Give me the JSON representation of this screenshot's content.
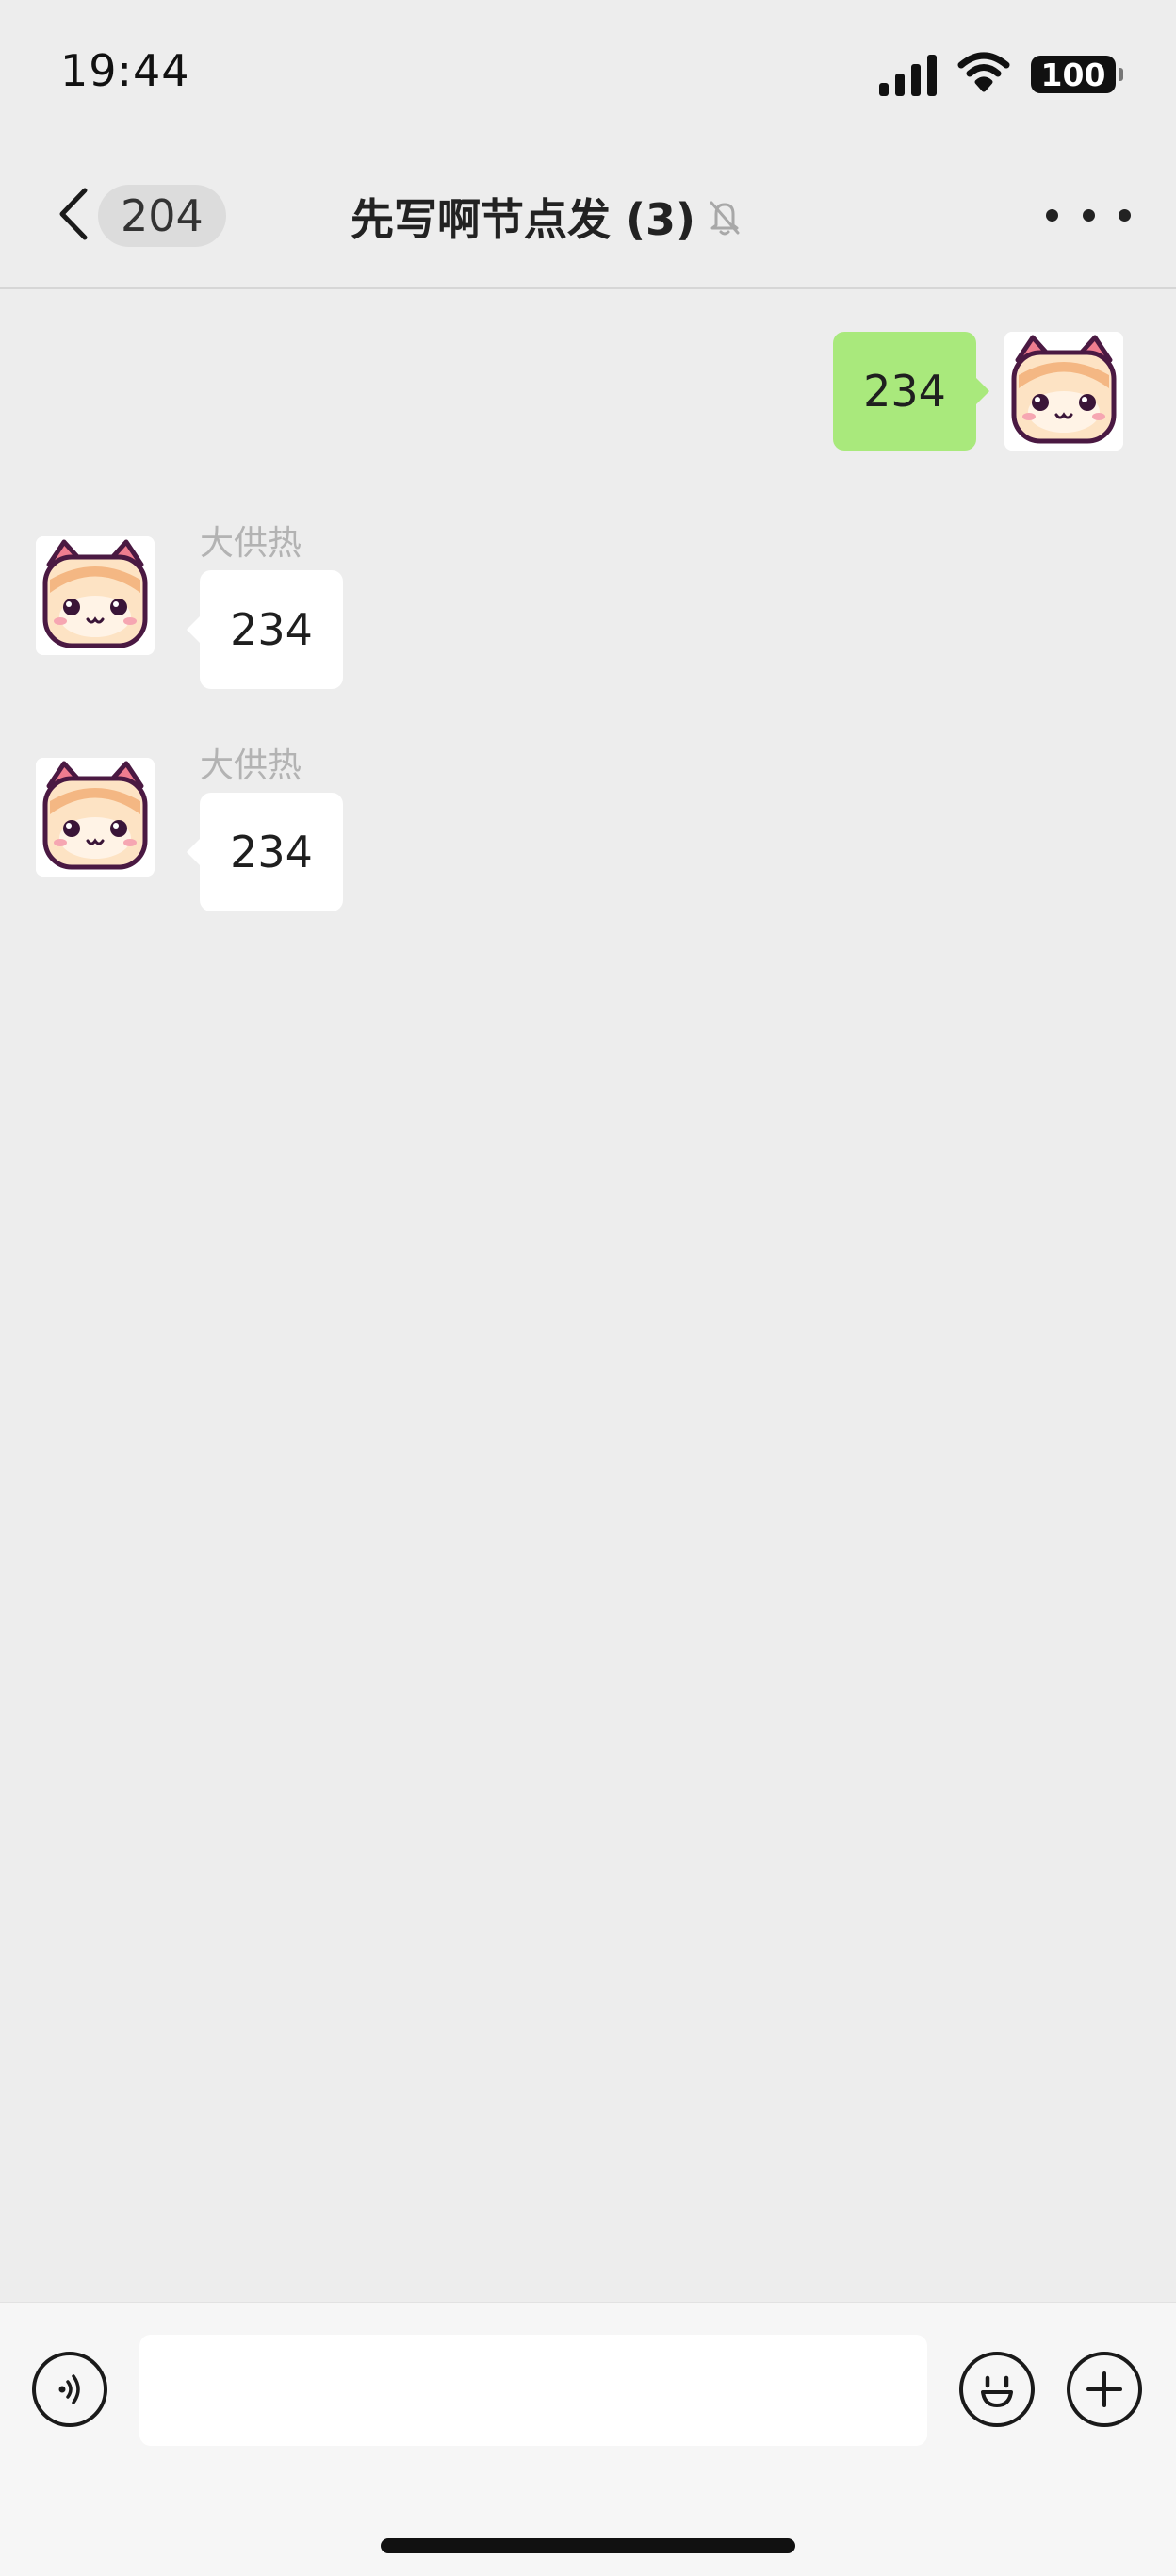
{
  "status_bar": {
    "time": "19:44",
    "battery": "100",
    "icons": [
      "signal-icon",
      "wifi-icon",
      "battery-icon"
    ]
  },
  "nav": {
    "unread_count": "204",
    "title": "先写啊节点发 (3)",
    "icons": [
      "chevron-left-icon",
      "bell-off-icon",
      "more-icon"
    ]
  },
  "messages": [
    {
      "direction": "out",
      "text": "234"
    },
    {
      "direction": "in",
      "sender": "大供热",
      "text": "234"
    },
    {
      "direction": "in",
      "sender": "大供热",
      "text": "234"
    }
  ],
  "input_bar": {
    "text_value": "",
    "icons": [
      "voice-icon",
      "emoji-icon",
      "plus-icon"
    ]
  },
  "colors": {
    "background": "#ededed",
    "outgoing_bubble": "#a9e97c",
    "incoming_bubble": "#ffffff",
    "sender_name": "#b3b3b3"
  }
}
